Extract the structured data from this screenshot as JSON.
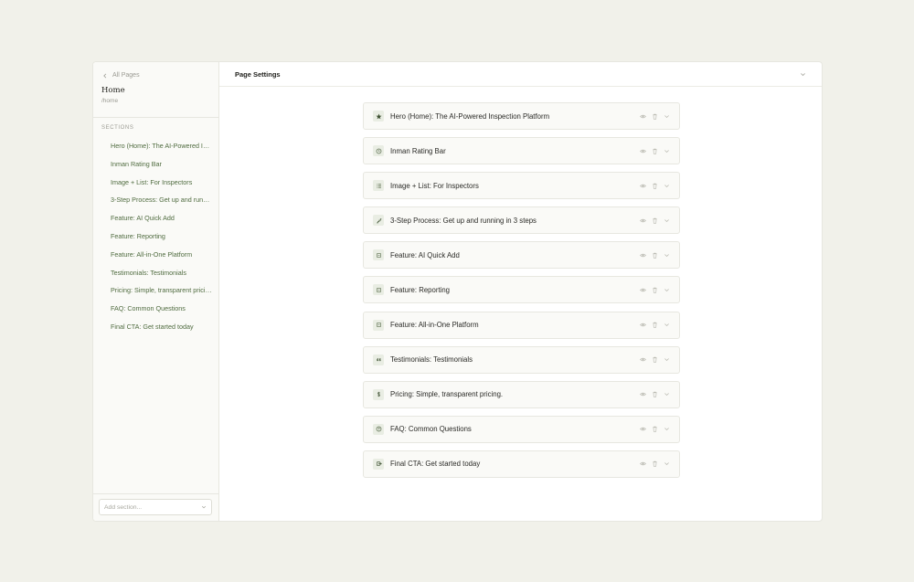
{
  "sidebar": {
    "back_label": "All Pages",
    "page_name": "Home",
    "page_path": "/home",
    "sections_heading": "Sections",
    "items": [
      {
        "label": "Hero (Home): The AI-Powered Inspection Platform"
      },
      {
        "label": "Inman Rating Bar"
      },
      {
        "label": "Image + List: For Inspectors"
      },
      {
        "label": "3-Step Process: Get up and running in 3 steps"
      },
      {
        "label": "Feature: AI Quick Add"
      },
      {
        "label": "Feature: Reporting"
      },
      {
        "label": "Feature: All-in-One Platform"
      },
      {
        "label": "Testimonials: Testimonials"
      },
      {
        "label": "Pricing: Simple, transparent pricing."
      },
      {
        "label": "FAQ: Common Questions"
      },
      {
        "label": "Final CTA: Get started today"
      }
    ],
    "add_section_placeholder": "Add section..."
  },
  "main": {
    "title": "Page Settings",
    "sections": [
      {
        "label": "Hero (Home): The AI-Powered Inspection Platform",
        "icon": "star-icon"
      },
      {
        "label": "Inman Rating Bar",
        "icon": "clock-icon"
      },
      {
        "label": "Image + List: For Inspectors",
        "icon": "list-icon"
      },
      {
        "label": "3-Step Process: Get up and running in 3 steps",
        "icon": "steps-icon"
      },
      {
        "label": "Feature: AI Quick Add",
        "icon": "feature-icon"
      },
      {
        "label": "Feature: Reporting",
        "icon": "feature-icon"
      },
      {
        "label": "Feature: All-in-One Platform",
        "icon": "feature-icon"
      },
      {
        "label": "Testimonials: Testimonials",
        "icon": "quote-icon"
      },
      {
        "label": "Pricing: Simple, transparent pricing.",
        "icon": "dollar-icon"
      },
      {
        "label": "FAQ: Common Questions",
        "icon": "question-icon"
      },
      {
        "label": "Final CTA: Get started today",
        "icon": "cta-icon"
      }
    ]
  },
  "colors": {
    "background": "#f1f1ea",
    "accent_text": "#4f6b3f",
    "icon_tint": "#5b6e4e"
  }
}
